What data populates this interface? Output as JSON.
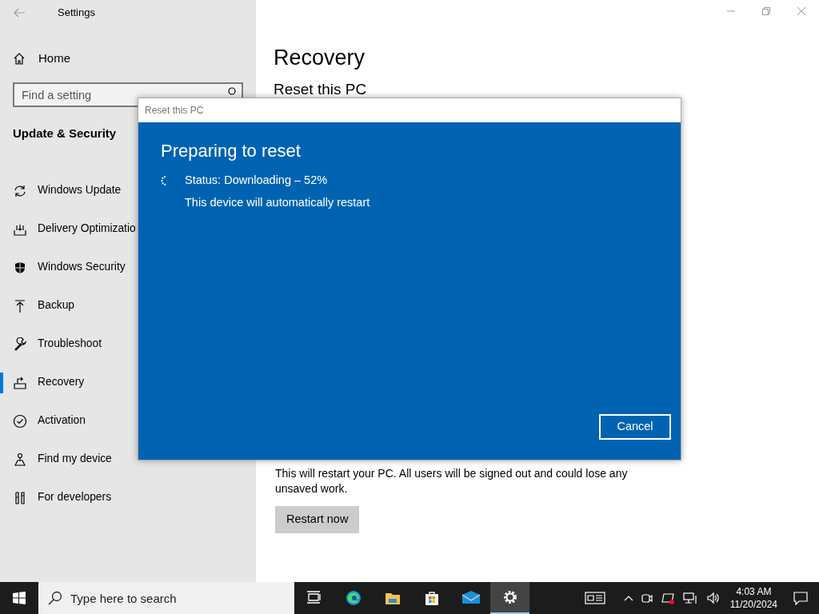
{
  "window": {
    "title": "Settings"
  },
  "sidebar": {
    "home": "Home",
    "search": {
      "placeholder": "Find a setting"
    },
    "section": "Update & Security",
    "items": [
      {
        "label": "Windows Update",
        "kind": "update",
        "selected": false
      },
      {
        "label": "Delivery Optimizatio",
        "kind": "delivery",
        "selected": false
      },
      {
        "label": "Windows Security",
        "kind": "security",
        "selected": false
      },
      {
        "label": "Backup",
        "kind": "backup",
        "selected": false
      },
      {
        "label": "Troubleshoot",
        "kind": "troubleshoot",
        "selected": false
      },
      {
        "label": "Recovery",
        "kind": "recovery",
        "selected": true
      },
      {
        "label": "Activation",
        "kind": "activation",
        "selected": false
      },
      {
        "label": "Find my device",
        "kind": "find",
        "selected": false
      },
      {
        "label": "For developers",
        "kind": "developers",
        "selected": false
      }
    ]
  },
  "main": {
    "heading": "Recovery",
    "section_title": "Reset this PC",
    "paragraph": "This will restart your PC. All users will be signed out and could lose any unsaved work.",
    "button": "Restart now"
  },
  "dialog": {
    "title": "Reset this PC",
    "heading": "Preparing to reset",
    "status": "Status: Downloading – 52%",
    "note": "This device will automatically restart",
    "button": "Cancel"
  },
  "taskbar": {
    "search": {
      "placeholder": "Type here to search"
    },
    "apps": [
      {
        "kind": "taskview",
        "selected": false
      },
      {
        "kind": "edge",
        "selected": false
      },
      {
        "kind": "explorer",
        "selected": false
      },
      {
        "kind": "store",
        "selected": false
      },
      {
        "kind": "mail",
        "selected": false
      },
      {
        "kind": "settings",
        "selected": true
      }
    ],
    "time": "4:03 AM",
    "date": "11/20/2024"
  }
}
